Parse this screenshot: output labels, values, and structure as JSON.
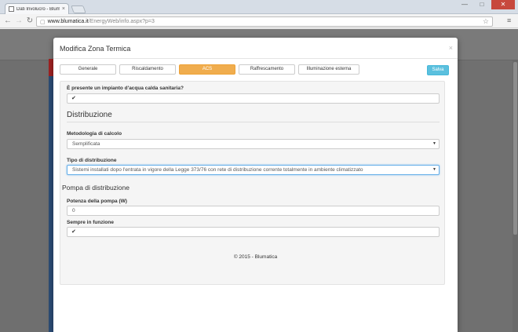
{
  "browser": {
    "tab_title": "Dati Involucro - Blumatic",
    "tab_close": "×",
    "url_host": "www.blumatica.it",
    "url_path": "/EnergyWeb/info.aspx?p=3",
    "controls": {
      "minimize": "—",
      "maximize": "□",
      "close": "✕"
    }
  },
  "modal": {
    "title": "Modifica Zona Termica",
    "close_label": "×",
    "save_label": "Salva",
    "tabs": [
      {
        "label": "Generale",
        "active": false
      },
      {
        "label": "Riscaldamento",
        "active": false
      },
      {
        "label": "ACS",
        "active": true
      },
      {
        "label": "Raffrescamento",
        "active": false
      },
      {
        "label": "Illuminazione esterna",
        "active": false
      }
    ],
    "form": {
      "acs_question": "È presente un impianto d'acqua calda sanitaria?",
      "acs_checked": true,
      "distribution_title": "Distribuzione",
      "method_label": "Metodologia di calcolo",
      "method_value": "Semplificata",
      "type_label": "Tipo di distribuzione",
      "type_value": "Sistemi installati dopo l'entrata in vigore della Legge 373/76 con rete di distribuzione corrente totalmente in ambiente climatizzato",
      "pump_title": "Pompa di distribuzione",
      "pump_power_label": "Potenza della pompa (W)",
      "pump_power_value": "0",
      "always_on_label": "Sempre in funzione",
      "always_on_checked": true
    },
    "footer": "© 2015 - Blumatica"
  },
  "colors": {
    "active_tab": "#f0ad4e",
    "save_button": "#5bc0de",
    "overlay": "#6f6f6f"
  }
}
